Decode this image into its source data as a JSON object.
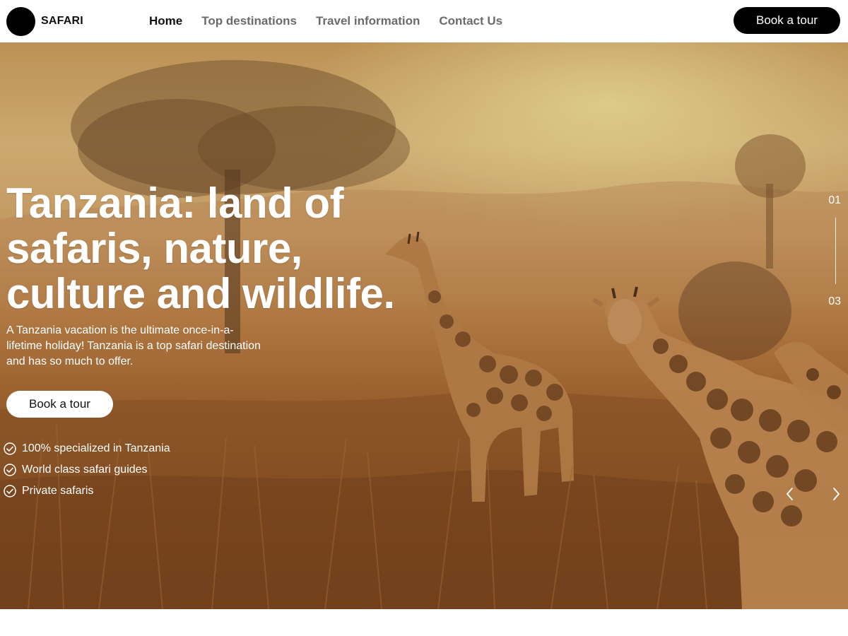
{
  "header": {
    "logo_text": "SAFARI",
    "nav": [
      {
        "label": "Home",
        "active": true
      },
      {
        "label": "Top destinations",
        "active": false
      },
      {
        "label": "Travel information",
        "active": false
      },
      {
        "label": "Contact Us",
        "active": false
      }
    ],
    "cta_label": "Book a tour"
  },
  "hero": {
    "title_lines": [
      "Tanzania: land of",
      "safaris, nature,",
      "culture and wildlife."
    ],
    "subtitle": "A Tanzania vacation is the ultimate once-in-a-lifetime holiday! Tanzania is a top safari destination and has so much to offer.",
    "cta_label": "Book a tour",
    "features": [
      "100% specialized in Tanzania",
      "World class safari guides",
      "Private safaris"
    ],
    "slider": {
      "current": "01",
      "total": "03"
    },
    "icons": {
      "feature": "check-circle-icon",
      "prev": "chevron-left-icon",
      "next": "chevron-right-icon"
    }
  },
  "colors": {
    "primary": "#000000",
    "nav_active": "#111111",
    "nav_inactive": "#6b6b6b",
    "hero_text": "#ffffff"
  }
}
